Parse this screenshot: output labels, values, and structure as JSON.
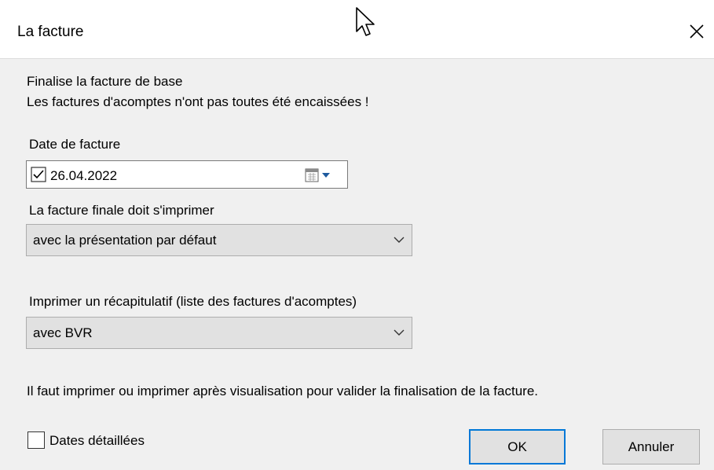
{
  "window": {
    "title": "La facture"
  },
  "messages": {
    "line1": "Finalise la facture de base",
    "line2": "Les factures d'acomptes n'ont pas toutes été encaissées !"
  },
  "invoice_date": {
    "label": "Date de facture",
    "checked": true,
    "value": "26.04.2022"
  },
  "final_print": {
    "label": "La facture finale doit s'imprimer",
    "selected": "avec la présentation par défaut"
  },
  "summary_print": {
    "label": "Imprimer un récapitulatif (liste des factures d'acomptes)",
    "selected": "avec BVR"
  },
  "notice": "Il faut imprimer ou imprimer après visualisation pour valider la finalisation de la facture.",
  "detailed_dates": {
    "label": "Dates détaillées",
    "checked": false
  },
  "buttons": {
    "ok": "OK",
    "cancel": "Annuler"
  },
  "colors": {
    "default_button_border": "#0078d7",
    "dialog_background": "#f0f0f0"
  }
}
